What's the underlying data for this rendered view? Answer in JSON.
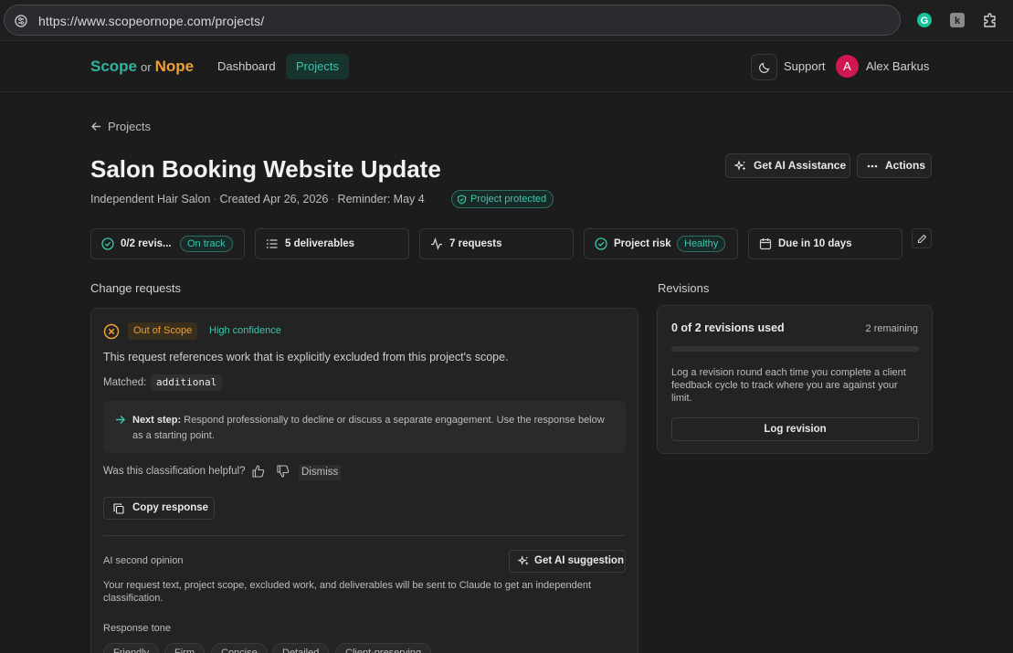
{
  "browser": {
    "url": "https://www.scopeornope.com/projects/",
    "extensions": [
      "grammarly-icon",
      "k-extension-icon",
      "puzzle-icon"
    ]
  },
  "header": {
    "logo": {
      "part1": "Scope",
      "part2": "or",
      "part3": "Nope"
    },
    "nav": {
      "dashboard": "Dashboard",
      "projects": "Projects"
    },
    "support": "Support",
    "user": {
      "initial": "A",
      "name": "Alex Barkus"
    }
  },
  "page": {
    "back_label": "Projects",
    "title": "Salon Booking Website Update",
    "client": "Independent Hair Salon",
    "created": "Created Apr 26, 2026",
    "reminder": "Reminder: May 4",
    "protected": "Project protected",
    "ai_button": "Get AI Assistance",
    "actions_button": "Actions"
  },
  "stats": {
    "revisions": {
      "label": "0/2 revis...",
      "badge": "On track"
    },
    "deliverables": {
      "label": "5 deliverables"
    },
    "requests": {
      "label": "7 requests"
    },
    "risk": {
      "label": "Project risk",
      "badge": "Healthy"
    },
    "due": {
      "label": "Due in 10 days"
    }
  },
  "change_requests": {
    "section_title": "Change requests",
    "status_badge": "Out of Scope",
    "confidence": "High confidence",
    "text": "This request references work that is explicitly excluded from this project's scope.",
    "matched_label": "Matched:",
    "matched_term": "additional",
    "next_step_label": "Next step:",
    "next_step_text": "Respond professionally to decline or discuss a separate engagement. Use the response below as a starting point.",
    "helpful_question": "Was this classification helpful?",
    "dismiss": "Dismiss",
    "copy_response": "Copy response",
    "second_opinion_label": "AI second opinion",
    "get_suggestion": "Get AI suggestion",
    "second_opinion_desc": "Your request text, project scope, excluded work, and deliverables will be sent to Claude to get an independent classification.",
    "tone_label": "Response tone",
    "tones": [
      "Friendly",
      "Firm",
      "Concise",
      "Detailed",
      "Client-preserving"
    ]
  },
  "revisions": {
    "section_title": "Revisions",
    "title": "0 of 2 revisions used",
    "remaining": "2 remaining",
    "used_fraction": 0,
    "desc": "Log a revision round each time you complete a client feedback cycle to track where you are against your limit.",
    "log_button": "Log revision"
  },
  "colors": {
    "accent_teal": "#3cc6ae",
    "accent_orange": "#f0a030",
    "avatar": "#d0174f",
    "background": "#1c1c1c"
  }
}
